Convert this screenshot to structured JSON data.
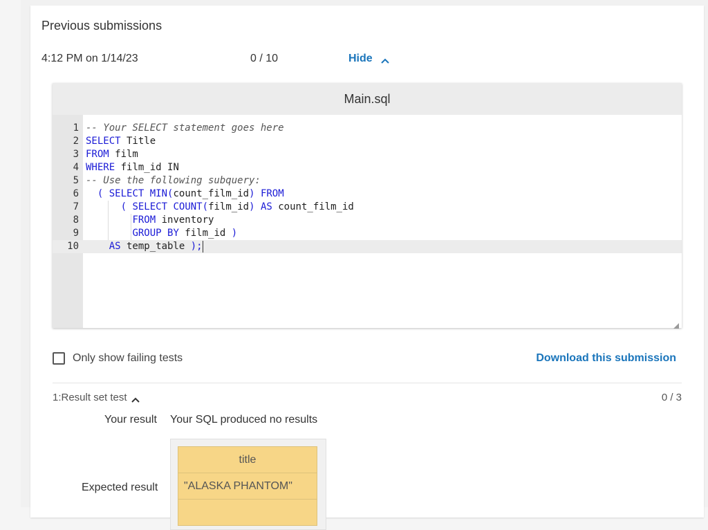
{
  "submissions": {
    "title": "Previous submissions",
    "time": "4:12 PM on 1/14/23",
    "score": "0 / 10",
    "hide_label": "Hide"
  },
  "editor": {
    "filename": "Main.sql",
    "active_line": 10,
    "lines": [
      {
        "n": "1",
        "tokens": [
          {
            "t": "-- Your SELECT statement goes here",
            "c": "cmt"
          }
        ]
      },
      {
        "n": "2",
        "tokens": [
          {
            "t": "SELECT",
            "c": "kw"
          },
          {
            "t": " Title",
            "c": "tx"
          }
        ]
      },
      {
        "n": "3",
        "tokens": [
          {
            "t": "FROM",
            "c": "kw"
          },
          {
            "t": " film",
            "c": "tx"
          }
        ]
      },
      {
        "n": "4",
        "tokens": [
          {
            "t": "WHERE",
            "c": "kw"
          },
          {
            "t": " film_id IN",
            "c": "tx"
          }
        ]
      },
      {
        "n": "5",
        "tokens": [
          {
            "t": "-- Use the following subquery:",
            "c": "cmt"
          }
        ]
      },
      {
        "n": "6",
        "tokens": [
          {
            "t": "  ",
            "c": "tx"
          },
          {
            "t": "(",
            "c": "paren"
          },
          {
            "t": " ",
            "c": "tx"
          },
          {
            "t": "SELECT",
            "c": "kw"
          },
          {
            "t": " ",
            "c": "tx"
          },
          {
            "t": "MIN",
            "c": "fn"
          },
          {
            "t": "(",
            "c": "paren"
          },
          {
            "t": "count_film_id",
            "c": "tx"
          },
          {
            "t": ")",
            "c": "paren"
          },
          {
            "t": " ",
            "c": "tx"
          },
          {
            "t": "FROM",
            "c": "kw"
          }
        ]
      },
      {
        "n": "7",
        "tokens": [
          {
            "t": "      ",
            "c": "tx"
          },
          {
            "t": "(",
            "c": "paren"
          },
          {
            "t": " ",
            "c": "tx"
          },
          {
            "t": "SELECT",
            "c": "kw"
          },
          {
            "t": " ",
            "c": "tx"
          },
          {
            "t": "COUNT",
            "c": "fn"
          },
          {
            "t": "(",
            "c": "paren"
          },
          {
            "t": "film_id",
            "c": "tx"
          },
          {
            "t": ")",
            "c": "paren"
          },
          {
            "t": " ",
            "c": "tx"
          },
          {
            "t": "AS",
            "c": "kw"
          },
          {
            "t": " count_film_id",
            "c": "tx"
          }
        ]
      },
      {
        "n": "8",
        "tokens": [
          {
            "t": "        ",
            "c": "tx"
          },
          {
            "t": "FROM",
            "c": "kw"
          },
          {
            "t": " inventory",
            "c": "tx"
          }
        ]
      },
      {
        "n": "9",
        "tokens": [
          {
            "t": "        ",
            "c": "tx"
          },
          {
            "t": "GROUP BY",
            "c": "kw"
          },
          {
            "t": " film_id ",
            "c": "tx"
          },
          {
            "t": ")",
            "c": "paren"
          }
        ]
      },
      {
        "n": "10",
        "tokens": [
          {
            "t": "    ",
            "c": "tx"
          },
          {
            "t": "AS",
            "c": "kw"
          },
          {
            "t": " temp_table ",
            "c": "tx"
          },
          {
            "t": ");",
            "c": "paren"
          }
        ]
      }
    ]
  },
  "filter": {
    "checkbox_label": "Only show failing tests",
    "download_label": "Download this submission"
  },
  "test": {
    "name": "1:Result set test",
    "score": "0 / 3",
    "your_result_label": "Your result",
    "your_result_value": "Your SQL produced no results",
    "expected_label": "Expected result",
    "expected_header": "title",
    "expected_rows": [
      "\"ALASKA PHANTOM\"",
      ""
    ]
  },
  "colors": {
    "link": "#1a75bb",
    "keyword": "#1a1ad6",
    "expected_cell": "#f7d687"
  }
}
